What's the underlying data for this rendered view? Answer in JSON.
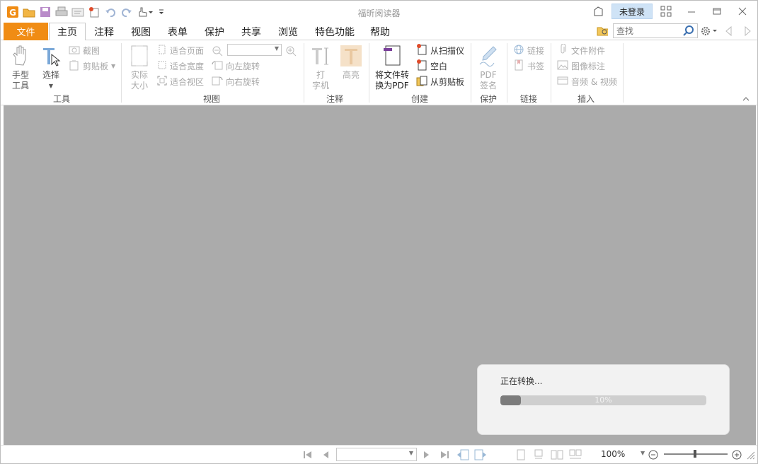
{
  "window": {
    "title": "福昕阅读器",
    "login_label": "未登录"
  },
  "menu": {
    "file_label": "文件",
    "tabs": [
      "主页",
      "注释",
      "视图",
      "表单",
      "保护",
      "共享",
      "浏览",
      "特色功能",
      "帮助"
    ],
    "search_placeholder": "查找"
  },
  "ribbon": {
    "tools": {
      "hand_line1": "手型",
      "hand_line2": "工具",
      "select": "选择",
      "group": "工具"
    },
    "view": {
      "actual_line1": "实际",
      "actual_line2": "大小",
      "screenshot": "截图",
      "clipboard": "剪贴板",
      "fit_page": "适合页面",
      "fit_width": "适合宽度",
      "fit_visible": "适合视区",
      "rotate_left": "向左旋转",
      "rotate_right": "向右旋转",
      "group": "视图"
    },
    "annotate": {
      "typewriter_line1": "打",
      "typewriter_line2": "字机",
      "highlight": "高亮",
      "group": "注释"
    },
    "create": {
      "convert_line1": "将文件转",
      "convert_line2": "换为PDF",
      "from_scanner": "从扫描仪",
      "blank": "空白",
      "from_clipboard": "从剪贴板",
      "group": "创建"
    },
    "protect": {
      "sign_line1": "PDF",
      "sign_line2": "签名",
      "group": "保护"
    },
    "links": {
      "link": "链接",
      "bookmark": "书签",
      "group": "链接"
    },
    "insert": {
      "attachment": "文件附件",
      "image": "图像标注",
      "av": "音频 & 视频",
      "group": "插入"
    }
  },
  "converting": {
    "message": "正在转换...",
    "progress_percent": 10,
    "progress_label": "10%"
  },
  "status": {
    "zoom": "100%",
    "zoom_slider_fraction": 0.49
  },
  "colors": {
    "accent_orange": "#f08c14",
    "doc_background": "#ababab",
    "login_bg": "#cfe3f6"
  }
}
